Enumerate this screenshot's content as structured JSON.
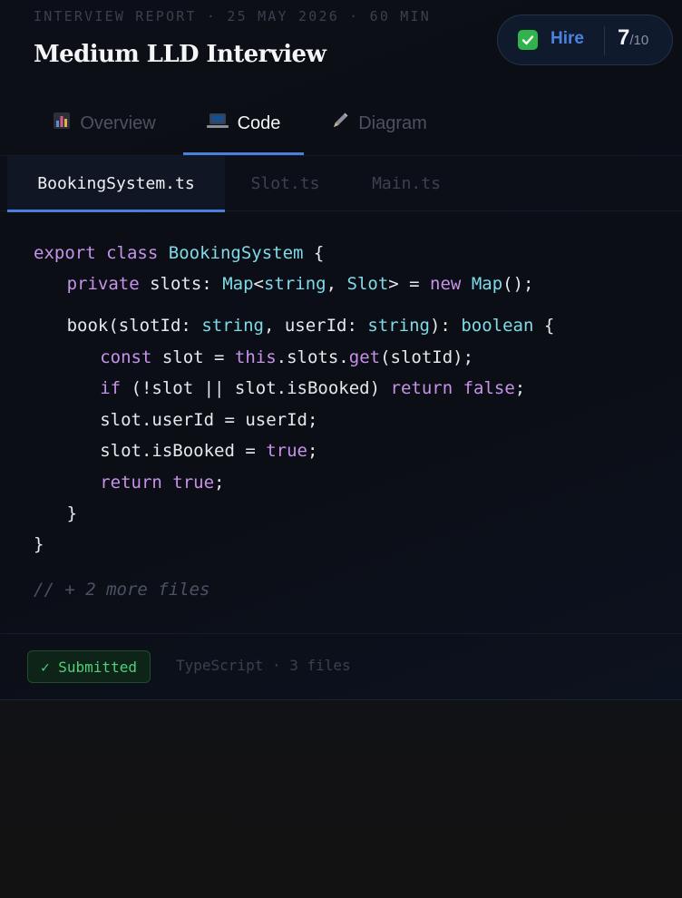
{
  "header": {
    "meta": "INTERVIEW REPORT · 25 MAY 2026 · 60 MIN",
    "title": "Medium LLD Interview"
  },
  "verdict": {
    "icon": "check-icon",
    "label": "Hire",
    "score": "7",
    "score_max": "/10",
    "accent": "#4a82e0",
    "icon_color": "#2fb34a"
  },
  "tabs": [
    {
      "label": "Overview",
      "icon": "bar-chart-icon",
      "active": false
    },
    {
      "label": "Code",
      "icon": "laptop-icon",
      "active": true
    },
    {
      "label": "Diagram",
      "icon": "pencil-icon",
      "active": false
    }
  ],
  "files": [
    {
      "label": "BookingSystem.ts",
      "active": true
    },
    {
      "label": "Slot.ts",
      "active": false
    },
    {
      "label": "Main.ts",
      "active": false
    }
  ],
  "code": {
    "lines": [
      "export class BookingSystem {",
      "  private slots: Map<string, Slot> = new Map();",
      "  book(slotId: string, userId: string): boolean {",
      "    const slot = this.slots.get(slotId);",
      "    if (!slot || slot.isBooked) return false;",
      "    slot.userId = userId;",
      "    slot.isBooked = true;",
      "    return true;",
      "  }",
      "}"
    ],
    "more_files": "// + 2 more files"
  },
  "footer": {
    "status_label": "✓ Submitted",
    "meta": "TypeScript · 3 files",
    "status_color": "#4fd07a"
  }
}
